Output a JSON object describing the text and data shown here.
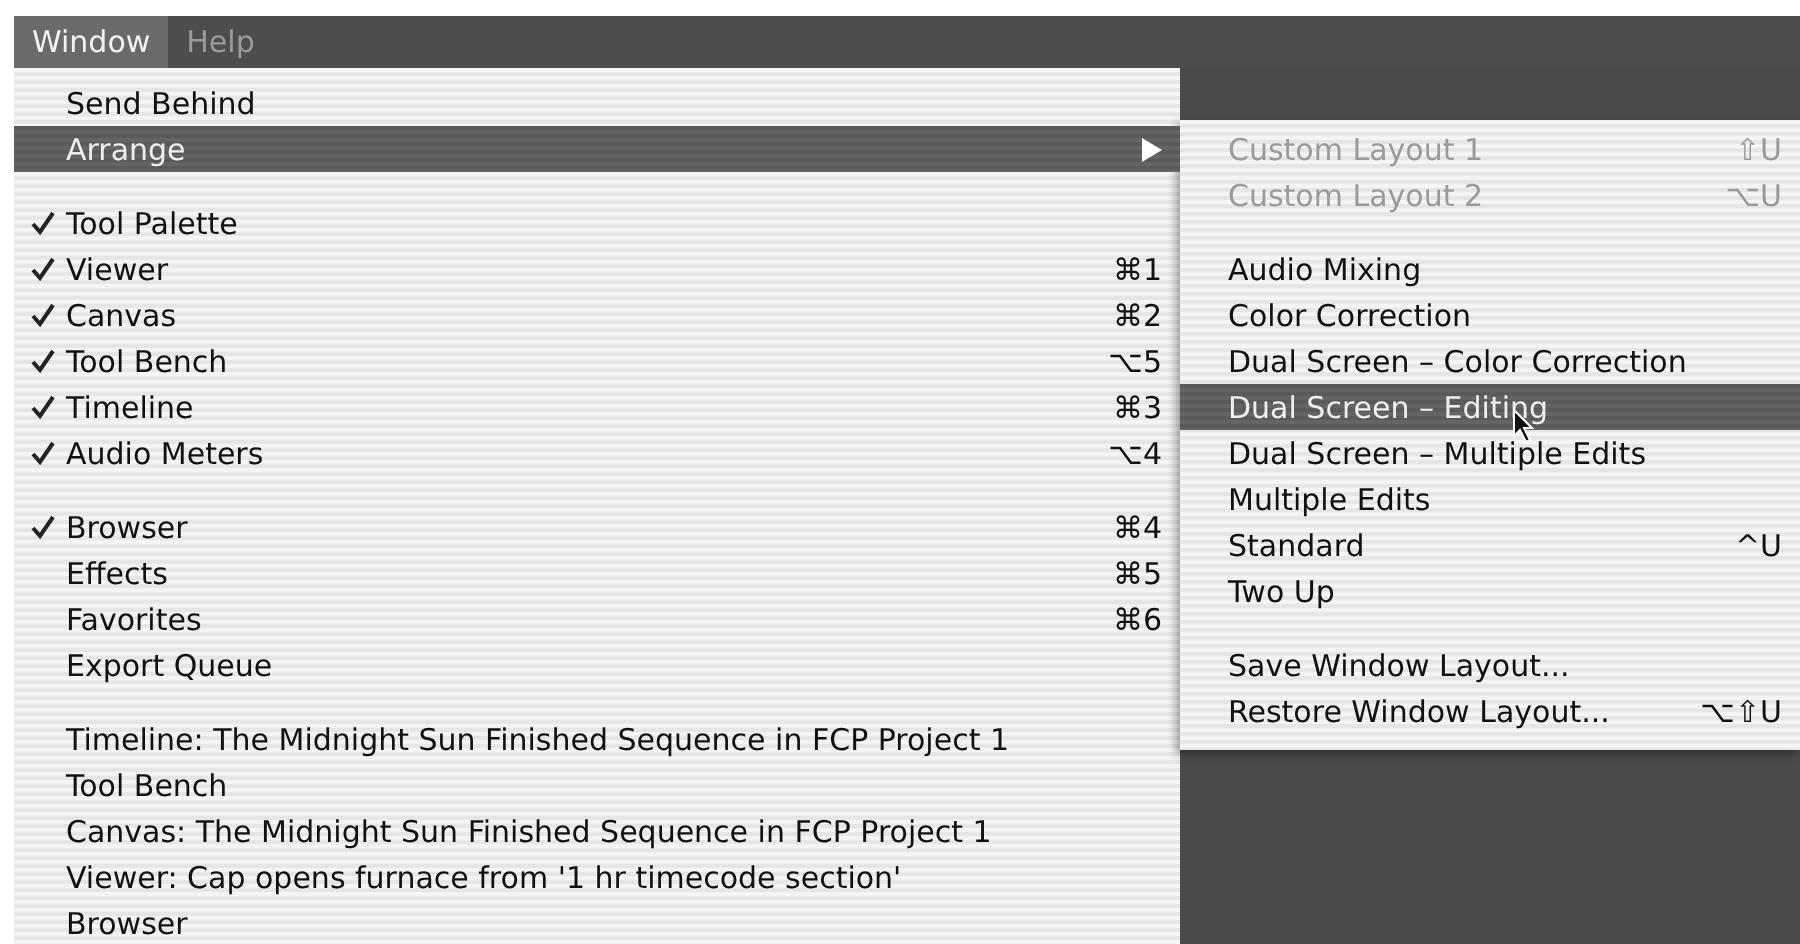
{
  "menubar": [
    {
      "label": "Window",
      "selected": true,
      "disabled": false
    },
    {
      "label": "Help",
      "selected": false,
      "disabled": true
    }
  ],
  "menu": {
    "items": [
      {
        "kind": "item",
        "label": "Send Behind",
        "checked": false,
        "selected": false
      },
      {
        "kind": "submenu",
        "label": "Arrange",
        "checked": false,
        "selected": true
      },
      {
        "kind": "separator"
      },
      {
        "kind": "item",
        "label": "Tool Palette",
        "checked": true,
        "selected": false
      },
      {
        "kind": "item",
        "label": "Viewer",
        "checked": true,
        "selected": false,
        "shortcut": "⌘1"
      },
      {
        "kind": "item",
        "label": "Canvas",
        "checked": true,
        "selected": false,
        "shortcut": "⌘2"
      },
      {
        "kind": "item",
        "label": "Tool Bench",
        "checked": true,
        "selected": false,
        "shortcut": "⌥5"
      },
      {
        "kind": "item",
        "label": "Timeline",
        "checked": true,
        "selected": false,
        "shortcut": "⌘3"
      },
      {
        "kind": "item",
        "label": "Audio Meters",
        "checked": true,
        "selected": false,
        "shortcut": "⌥4"
      },
      {
        "kind": "separator"
      },
      {
        "kind": "item",
        "label": "Browser",
        "checked": true,
        "selected": false,
        "shortcut": "⌘4"
      },
      {
        "kind": "item",
        "label": "Effects",
        "checked": false,
        "selected": false,
        "shortcut": "⌘5"
      },
      {
        "kind": "item",
        "label": "Favorites",
        "checked": false,
        "selected": false,
        "shortcut": "⌘6"
      },
      {
        "kind": "item",
        "label": "Export Queue",
        "checked": false,
        "selected": false
      },
      {
        "kind": "separator"
      },
      {
        "kind": "item",
        "label": "Timeline: The Midnight Sun Finished Sequence in FCP Project 1",
        "checked": false,
        "selected": false
      },
      {
        "kind": "item",
        "label": "Tool Bench",
        "checked": false,
        "selected": false
      },
      {
        "kind": "item",
        "label": "Canvas: The Midnight Sun Finished Sequence in FCP Project 1",
        "checked": false,
        "selected": false
      },
      {
        "kind": "item",
        "label": "Viewer: Cap opens furnace from '1 hr timecode section'",
        "checked": false,
        "selected": false
      },
      {
        "kind": "item",
        "label": "Browser",
        "checked": false,
        "selected": false
      }
    ]
  },
  "submenu": {
    "items": [
      {
        "kind": "item",
        "label": "Custom Layout 1",
        "disabled": true,
        "selected": false,
        "shortcut": "⇧U"
      },
      {
        "kind": "item",
        "label": "Custom Layout 2",
        "disabled": true,
        "selected": false,
        "shortcut": "⌥U"
      },
      {
        "kind": "separator"
      },
      {
        "kind": "item",
        "label": "Audio Mixing",
        "disabled": false,
        "selected": false
      },
      {
        "kind": "item",
        "label": "Color Correction",
        "disabled": false,
        "selected": false
      },
      {
        "kind": "item",
        "label": "Dual Screen – Color Correction",
        "disabled": false,
        "selected": false
      },
      {
        "kind": "item",
        "label": "Dual Screen – Editing",
        "disabled": false,
        "selected": true
      },
      {
        "kind": "item",
        "label": "Dual Screen – Multiple Edits",
        "disabled": false,
        "selected": false
      },
      {
        "kind": "item",
        "label": "Multiple Edits",
        "disabled": false,
        "selected": false
      },
      {
        "kind": "item",
        "label": "Standard",
        "disabled": false,
        "selected": false,
        "shortcut": "^U"
      },
      {
        "kind": "item",
        "label": "Two Up",
        "disabled": false,
        "selected": false
      },
      {
        "kind": "separator"
      },
      {
        "kind": "item",
        "label": "Save Window Layout...",
        "disabled": false,
        "selected": false
      },
      {
        "kind": "item",
        "label": "Restore Window Layout...",
        "disabled": false,
        "selected": false,
        "shortcut": "⌥⇧U"
      }
    ]
  }
}
